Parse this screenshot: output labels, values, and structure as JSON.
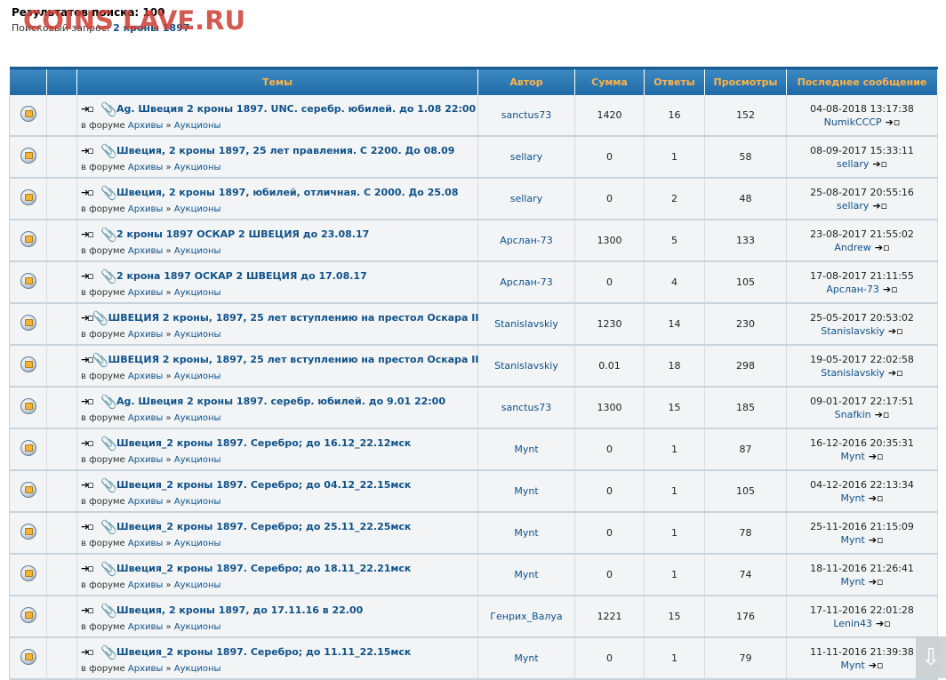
{
  "header": {
    "results_label": "Результатов поиска:",
    "results_count": "100",
    "query_label": "Поисковый запрос:",
    "query_value": "2 кроны 1897"
  },
  "watermark": "COINS LAVE.RU",
  "columns": {
    "topics": "Темы",
    "author": "Автор",
    "sum": "Сумма",
    "replies": "Ответы",
    "views": "Просмотры",
    "last_post": "Последнее сообщение"
  },
  "forum_prefix": "в форуме",
  "forum_path": [
    "Архивы",
    "Аукционы"
  ],
  "icons": {
    "topic": "topic-read-icon",
    "goto": "goto-first-unread-icon",
    "attachment": "paperclip-icon",
    "last_post": "goto-last-post-icon",
    "scroll": "scroll-down-arrow-icon"
  },
  "rows": [
    {
      "title": "Ag. Швеция 2 кроны 1897. UNC. серебр. юбилей. до 1.08 22:00",
      "author": "sanctus73",
      "sum": "1420",
      "replies": "16",
      "views": "152",
      "last_time": "04-08-2018 13:17:38",
      "last_user": "NumikCCCP"
    },
    {
      "title": "Швеция, 2 кроны 1897, 25 лет правления. С 2200. До 08.09",
      "author": "sellary",
      "sum": "0",
      "replies": "1",
      "views": "58",
      "last_time": "08-09-2017 15:33:11",
      "last_user": "sellary"
    },
    {
      "title": "Швеция, 2 кроны 1897, юбилей, отличная. С 2000. До 25.08",
      "author": "sellary",
      "sum": "0",
      "replies": "2",
      "views": "48",
      "last_time": "25-08-2017 20:55:16",
      "last_user": "sellary"
    },
    {
      "title": "2 кроны 1897 ОСКАР 2 ШВЕЦИЯ до 23.08.17",
      "author": "Арслан-73",
      "sum": "1300",
      "replies": "5",
      "views": "133",
      "last_time": "23-08-2017 21:55:02",
      "last_user": "Andrew"
    },
    {
      "title": "2 крона 1897 ОСКАР 2 ШВЕЦИЯ до 17.08.17",
      "author": "Арслан-73",
      "sum": "0",
      "replies": "4",
      "views": "105",
      "last_time": "17-08-2017 21:11:55",
      "last_user": "Арслан-73"
    },
    {
      "title": "ШВЕЦИЯ 2 кроны, 1897, 25 лет вступлению на престол Оскара II",
      "author": "Stanislavskiy",
      "sum": "1230",
      "replies": "14",
      "views": "230",
      "last_time": "25-05-2017 20:53:02",
      "last_user": "Stanislavskiy"
    },
    {
      "title": "ШВЕЦИЯ 2 кроны, 1897, 25 лет вступлению на престол Оскара II",
      "author": "Stanislavskiy",
      "sum": "0.01",
      "replies": "18",
      "views": "298",
      "last_time": "19-05-2017 22:02:58",
      "last_user": "Stanislavskiy"
    },
    {
      "title": "Ag. Швеция 2 кроны 1897. серебр. юбилей. до 9.01 22:00",
      "author": "sanctus73",
      "sum": "1300",
      "replies": "15",
      "views": "185",
      "last_time": "09-01-2017 22:17:51",
      "last_user": "Snafkin"
    },
    {
      "title": "Швеция_2 кроны 1897. Серебро; до 16.12_22.12мск",
      "author": "Mynt",
      "sum": "0",
      "replies": "1",
      "views": "87",
      "last_time": "16-12-2016 20:35:31",
      "last_user": "Mynt"
    },
    {
      "title": "Швеция_2 кроны 1897. Серебро; до 04.12_22.15мск",
      "author": "Mynt",
      "sum": "0",
      "replies": "1",
      "views": "105",
      "last_time": "04-12-2016 22:13:34",
      "last_user": "Mynt"
    },
    {
      "title": "Швеция_2 кроны 1897. Серебро; до 25.11_22.25мск",
      "author": "Mynt",
      "sum": "0",
      "replies": "1",
      "views": "78",
      "last_time": "25-11-2016 21:15:09",
      "last_user": "Mynt"
    },
    {
      "title": "Швеция_2 кроны 1897. Серебро; до 18.11_22.21мск",
      "author": "Mynt",
      "sum": "0",
      "replies": "1",
      "views": "74",
      "last_time": "18-11-2016 21:26:41",
      "last_user": "Mynt"
    },
    {
      "title": "Швеция, 2 кроны 1897, до 17.11.16 в 22.00",
      "author": "Генрих_Валуа",
      "sum": "1221",
      "replies": "15",
      "views": "176",
      "last_time": "17-11-2016 22:01:28",
      "last_user": "Lenin43"
    },
    {
      "title": "Швеция_2 кроны 1897. Серебро; до 11.11_22.15мск",
      "author": "Mynt",
      "sum": "0",
      "replies": "1",
      "views": "79",
      "last_time": "11-11-2016 21:39:38",
      "last_user": "Mynt"
    }
  ]
}
